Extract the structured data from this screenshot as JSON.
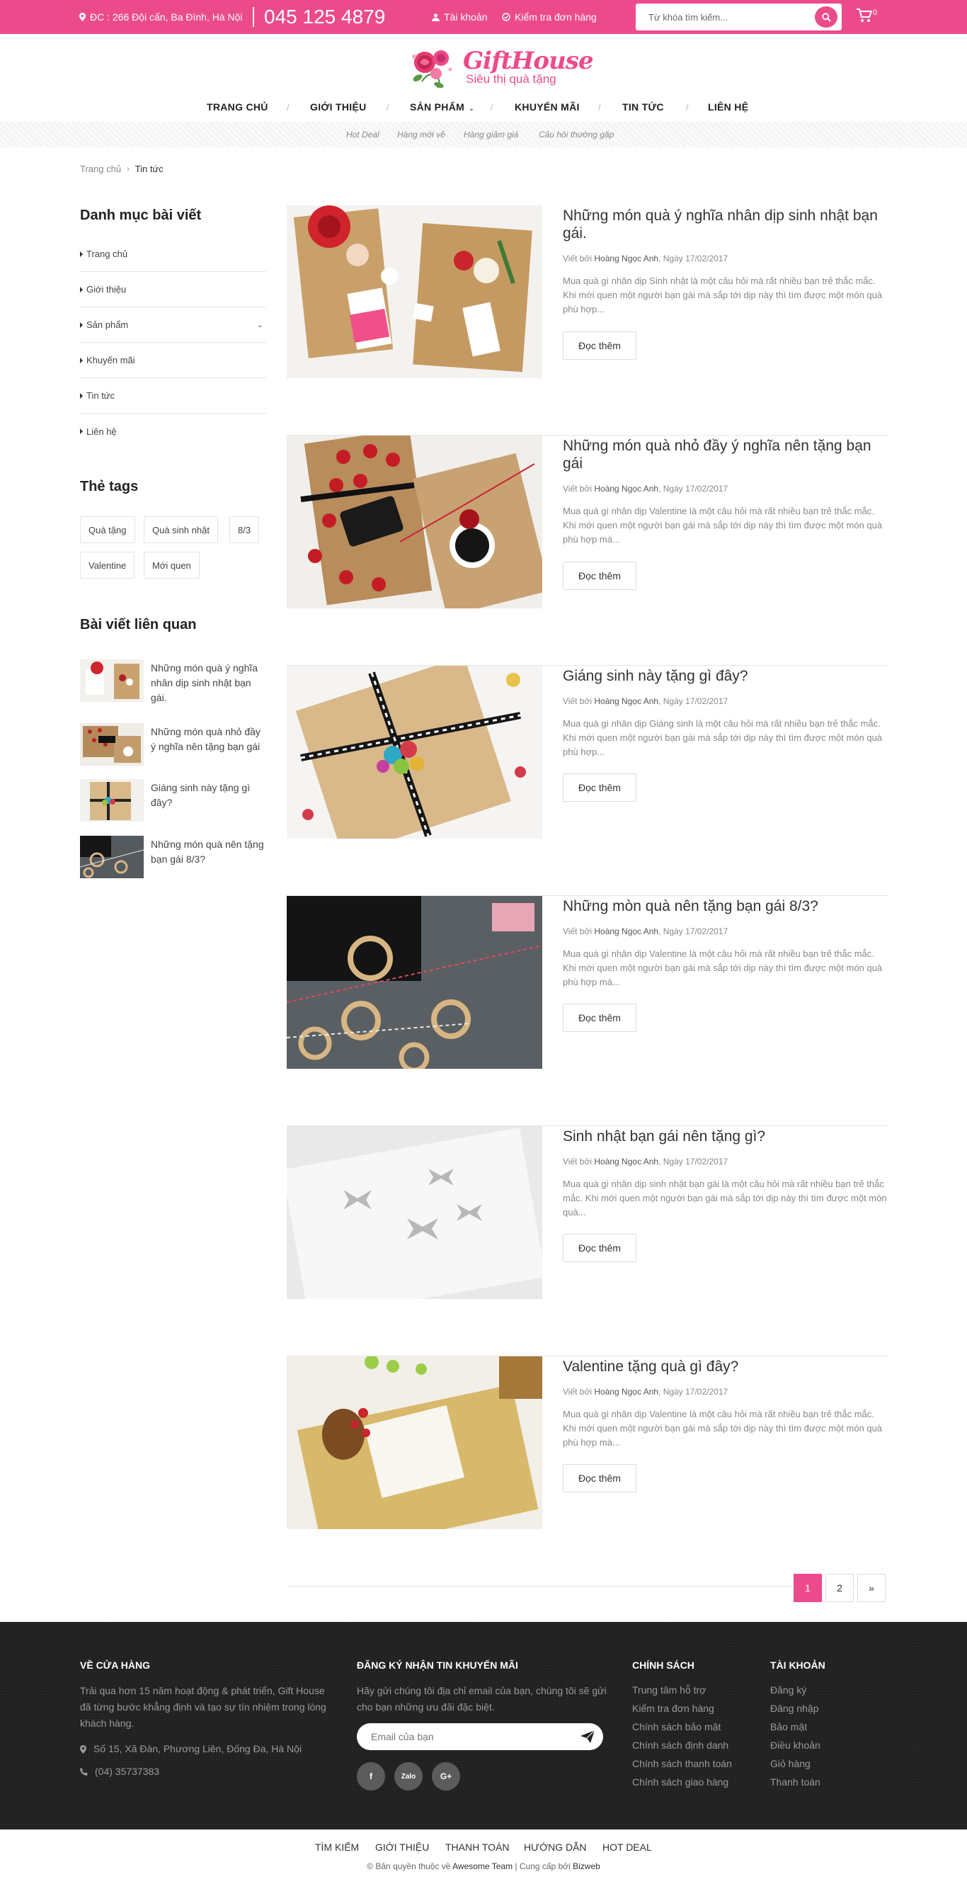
{
  "topbar": {
    "address": "ĐC : 266 Đội cấn, Ba Đình, Hà Nội",
    "phone": "045 125 4879",
    "account": "Tài khoản",
    "order_check": "Kiểm tra đơn hàng",
    "search_placeholder": "Từ khóa tìm kiếm...",
    "cart_count": "0",
    "accent": "#ec4b8b"
  },
  "logo": {
    "brand": "GiftHouse",
    "tagline": "Siêu thị quà tặng"
  },
  "nav": {
    "items": [
      "TRANG CHỦ",
      "GIỚI THIỆU",
      "SẢN PHẨM",
      "KHUYẾN MÃI",
      "TIN TỨC",
      "LIÊN HỆ"
    ],
    "sub": [
      "Hot Deal",
      "Hàng mới về",
      "Hàng giảm giá",
      "Câu hỏi thường gặp"
    ]
  },
  "breadcrumb": {
    "home": "Trang chủ",
    "current": "Tin tức"
  },
  "sidebar": {
    "categories_title": "Danh mục bài viết",
    "categories": [
      "Trang chủ",
      "Giới thiệu",
      "Sản phẩm",
      "Khuyến mãi",
      "Tin tức",
      "Liên hệ"
    ],
    "tags_title": "Thẻ tags",
    "tags": [
      "Quà tặng",
      "Quà sinh nhật",
      "8/3",
      "Valentine",
      "Mới quen"
    ],
    "related_title": "Bài viết liên quan",
    "related": [
      "Những món quà ý nghĩa nhân dịp sinh nhật bạn gái.",
      "Những món quà nhỏ đầy ý nghĩa nên tặng bạn gái",
      "Giáng sinh này tặng gì đây?",
      "Những món quà nên tặng bạn gái 8/3?"
    ]
  },
  "posts": [
    {
      "title": "Những món quà ý nghĩa nhân dịp sinh nhật bạn gái.",
      "by": "Viết bởi",
      "author": "Hoàng Ngọc Anh",
      "date": ", Ngày 17/02/2017",
      "excerpt": "Mua quà gì nhân dịp Sinh nhật là một câu hỏi mà rất nhiều bạn trẻ thắc mắc. Khi mới quen một người bạn gái mà sắp tới dịp này thì tìm được một món quà phù hợp...",
      "more": "Đọc thêm"
    },
    {
      "title": "Những món quà nhỏ đầy ý nghĩa nên tặng bạn gái",
      "by": "Viết bởi",
      "author": "Hoàng Ngọc Anh",
      "date": ", Ngày 17/02/2017",
      "excerpt": "Mua quà gì nhân dịp Valentine là một câu hỏi mà rất nhiều bạn trẻ thắc mắc. Khi mới quen một người bạn gái mà sắp tới dịp này thì tìm được một món quà phù hợp mà...",
      "more": "Đọc thêm"
    },
    {
      "title": "Giáng sinh này tặng gì đây?",
      "by": "Viết bởi",
      "author": "Hoàng Ngọc Anh",
      "date": ", Ngày 17/02/2017",
      "excerpt": "Mua quà gì nhân dịp Giáng sinh là một câu hỏi mà rất nhiều bạn trẻ thắc mắc. Khi mới quen một người bạn gái mà sắp tới dịp này thì tìm được một món quà phù hợp...",
      "more": "Đọc thêm"
    },
    {
      "title": "Những mòn quà nên tặng bạn gái 8/3?",
      "by": "Viết bởi",
      "author": "Hoàng Ngọc Anh",
      "date": ", Ngày 17/02/2017",
      "excerpt": "Mua quà gì nhân dịp Valentine là một câu hỏi mà rất nhiều bạn trẻ thắc mắc. Khi mới quen một người bạn gái mà sắp tới dịp này thì tìm được một món quà phù hợp mà...",
      "more": "Đọc thêm"
    },
    {
      "title": "Sinh nhật bạn gái nên tặng gì?",
      "by": "Viết bởi",
      "author": "Hoàng Ngọc Anh",
      "date": ", Ngày 17/02/2017",
      "excerpt": "Mua quà gì nhân dịp sinh nhật bạn gái là một câu hỏi mà rất nhiều bạn trẻ thắc mắc. Khi mới quen một người bạn gái mà sắp tới dịp này thì tìm được một món quà...",
      "more": "Đọc thêm"
    },
    {
      "title": "Valentine tặng quà gì đây?",
      "by": "Viết bởi",
      "author": "Hoàng Ngọc Anh",
      "date": ", Ngày 17/02/2017",
      "excerpt": "Mua quà gì nhân dịp Valentine là một câu hỏi mà rất nhiều bạn trẻ thắc mắc. Khi mới quen một người bạn gái mà sắp tới dịp này thì tìm được một món quà phù hợp mà...",
      "more": "Đọc thêm"
    }
  ],
  "pagination": {
    "pages": [
      "1",
      "2",
      "»"
    ],
    "current": "1"
  },
  "footer": {
    "about_title": "VỀ CỬA HÀNG",
    "about_text": "Trải qua hơn 15 năm hoạt động & phát triển, Gift House đã từng bước khẳng định và tạo sự tín nhiệm trong lòng khách hàng.",
    "address": "Số 15, Xã Đàn, Phương Liên, Đống Đa, Hà Nội",
    "phone": "(04) 35737383",
    "newsletter_title": "ĐĂNG KÝ NHẬN TIN KHUYẾN MÃI",
    "newsletter_text": "Hãy gửi chúng tôi địa chỉ email của bạn, chúng tôi sẽ gửi cho bạn những ưu đãi đặc biệt.",
    "email_placeholder": "Email của bạn",
    "social": [
      "f",
      "Zalo",
      "G+"
    ],
    "policy_title": "CHÍNH SÁCH",
    "policy": [
      "Trung tâm hỗ trợ",
      "Kiểm tra đơn hàng",
      "Chính sách bảo mật",
      "Chính sách định danh",
      "Chính sách thanh toán",
      "Chính sách giao hàng"
    ],
    "account_title": "TÀI KHOẢN",
    "account": [
      "Đăng ký",
      "Đăng nhập",
      "Bảo mật",
      "Điều khoản",
      "Giỏ hàng",
      "Thanh toán"
    ]
  },
  "bottom_nav": [
    "TÌM KIẾM",
    "GIỚI THIỆU",
    "THANH TOÁN",
    "HƯỚNG DẪN",
    "HOT DEAL"
  ],
  "copyright": {
    "prefix": "© Bản quyền thuộc về ",
    "owner": "Awesome Team",
    "mid": " | Cung cấp bởi ",
    "provider": "Bizweb"
  }
}
